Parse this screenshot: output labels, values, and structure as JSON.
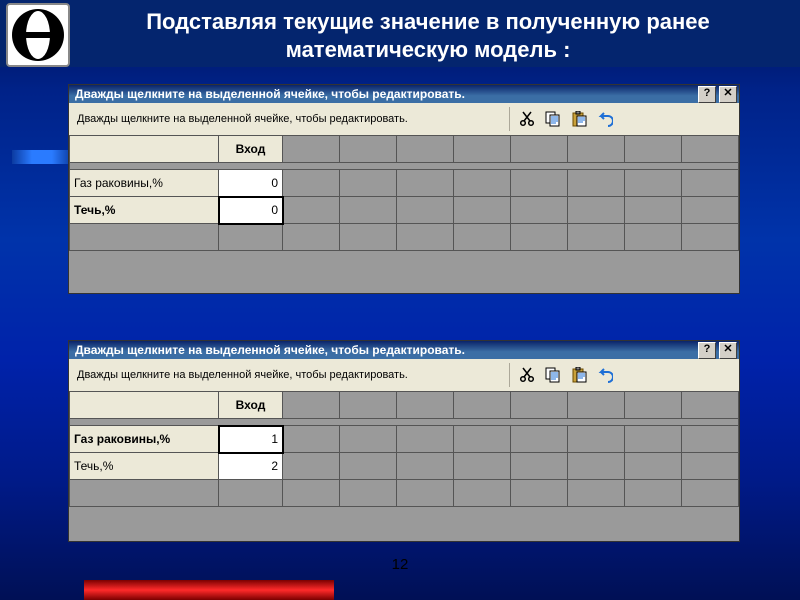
{
  "title": "Подставляя текущие значение в полученную ранее математическую модель :",
  "slide_number": "12",
  "panel_titlebar": "Дважды щелкните на выделенной ячейке, чтобы редактировать.",
  "panel_toolbar_text": "Дважды щелкните на выделенной ячейке, чтобы редактировать.",
  "col_header": "Вход",
  "panel1": {
    "rows": [
      {
        "label": "Газ раковины,%",
        "value": "0"
      },
      {
        "label": "Течь,%",
        "value": "0"
      }
    ]
  },
  "panel2": {
    "rows": [
      {
        "label": "Газ раковины,%",
        "value": "1"
      },
      {
        "label": "Течь,%",
        "value": "2"
      }
    ]
  },
  "icons": {
    "help": "?",
    "close": "✕",
    "cut": "cut-icon",
    "copy": "copy-icon",
    "paste": "paste-icon",
    "undo": "undo-icon"
  }
}
